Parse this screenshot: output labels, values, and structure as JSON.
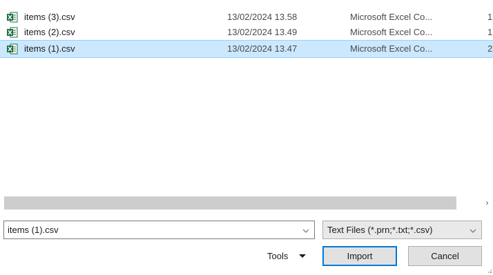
{
  "files": [
    {
      "name": "items (3).csv",
      "date": "13/02/2024 13.58",
      "type": "Microsoft Excel Co...",
      "size": "1",
      "selected": false
    },
    {
      "name": "items (2).csv",
      "date": "13/02/2024 13.49",
      "type": "Microsoft Excel Co...",
      "size": "1",
      "selected": false
    },
    {
      "name": "items (1).csv",
      "date": "13/02/2024 13.47",
      "type": "Microsoft Excel Co...",
      "size": "2",
      "selected": true
    }
  ],
  "scrollbar": {
    "right_arrow": "›"
  },
  "filename": {
    "value": "items (1).csv"
  },
  "filetype": {
    "value": "Text Files (*.prn;*.txt;*.csv)"
  },
  "tools": {
    "label": "Tools"
  },
  "buttons": {
    "import": "Import",
    "cancel": "Cancel"
  },
  "colors": {
    "selection": "#cce8ff",
    "selection_border": "#99d1ff",
    "default_button_border": "#0078d7",
    "excel_green": "#1d6f42"
  },
  "icons": {
    "file": "excel-csv-icon"
  }
}
